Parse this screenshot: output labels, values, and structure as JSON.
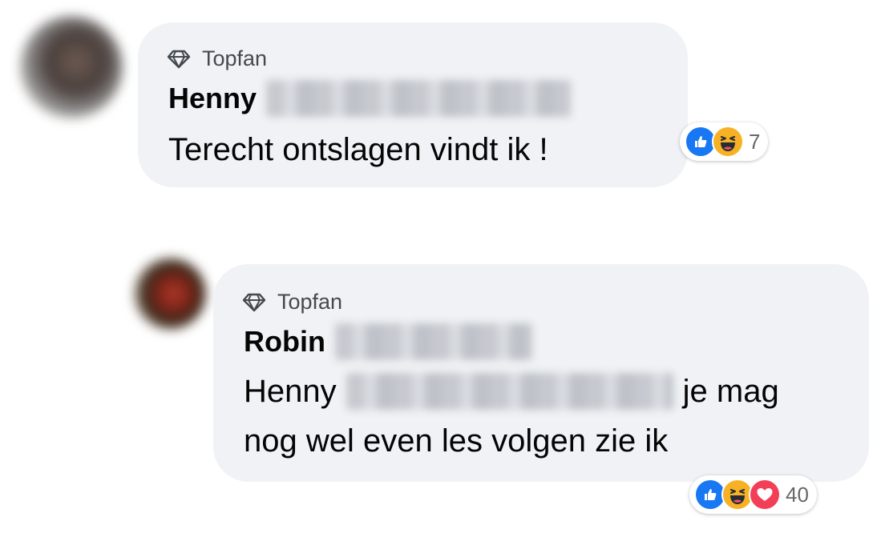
{
  "comments": [
    {
      "badge": "Topfan",
      "author_first": "Henny",
      "text_lines": [
        "Terecht ontslagen vindt ik !"
      ],
      "reactions": [
        "like",
        "haha"
      ],
      "reaction_count": "7"
    },
    {
      "badge": "Topfan",
      "author_first": "Robin",
      "mention": "Henny",
      "text_after_mention": "je mag",
      "text_line_2": "nog wel even les volgen zie ik",
      "reactions": [
        "like",
        "haha",
        "love"
      ],
      "reaction_count": "40"
    }
  ],
  "colors": {
    "bubble": "#f0f2f5",
    "like": "#1877f2",
    "haha": "#f7b125",
    "love": "#f33e58",
    "muted_text": "#65676b"
  },
  "icons": {
    "badge": "diamond-icon",
    "like": "like-icon",
    "haha": "haha-icon",
    "love": "love-icon"
  }
}
